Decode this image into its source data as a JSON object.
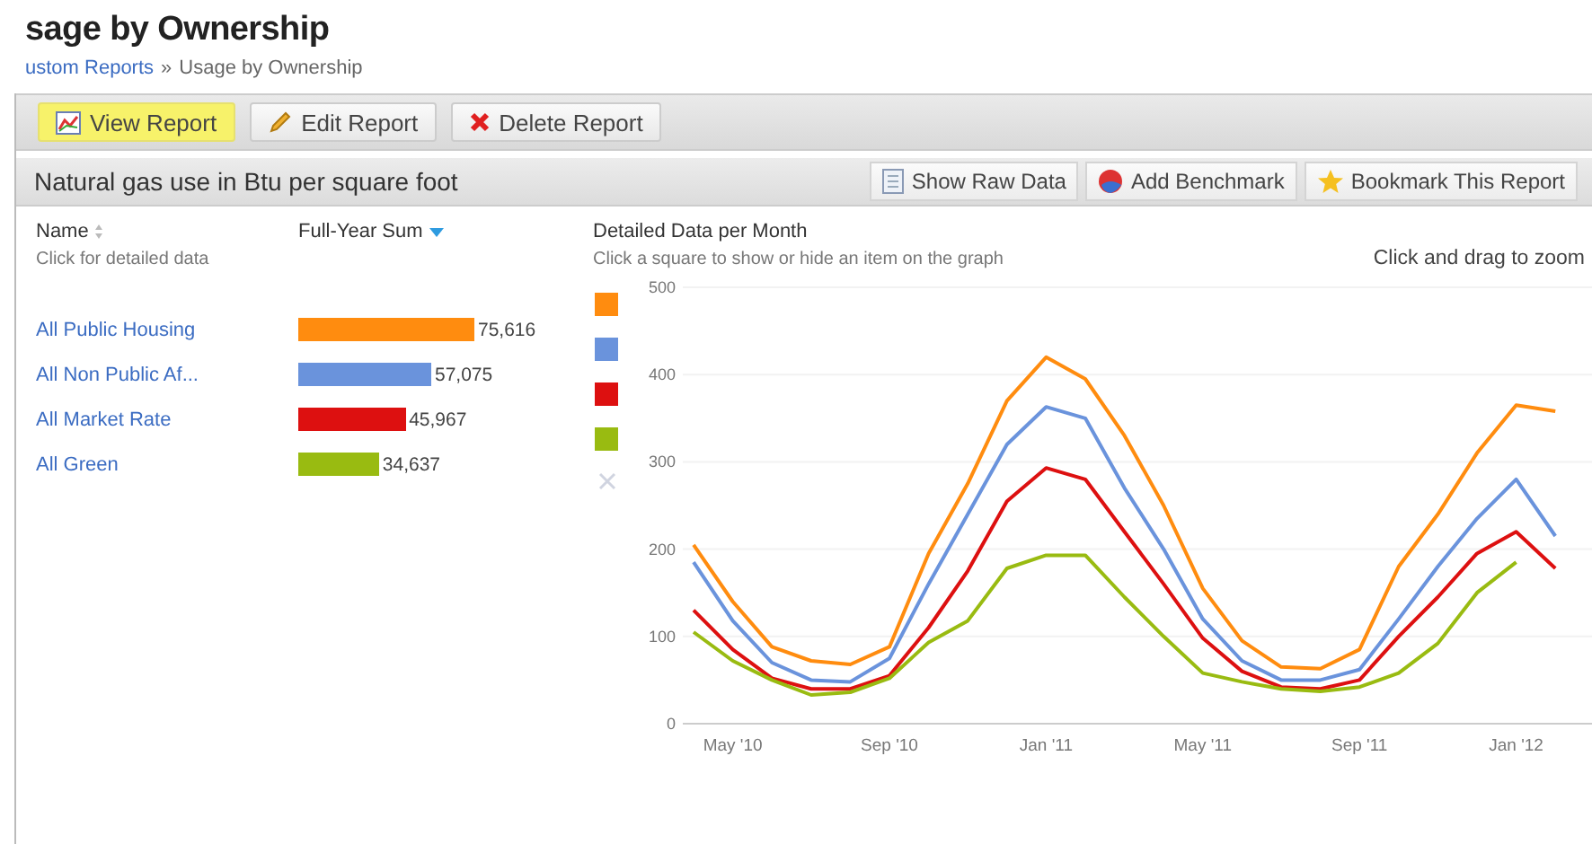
{
  "page": {
    "title": "sage by Ownership",
    "breadcrumb": [
      {
        "label": "ustom Reports"
      },
      {
        "label": "»"
      },
      {
        "label": "Usage by Ownership"
      }
    ]
  },
  "toolbar": [
    {
      "label": "View Report",
      "selected": true
    },
    {
      "label": "Edit Report",
      "selected": false
    },
    {
      "label": "Delete Report",
      "selected": false
    }
  ],
  "report_bar": {
    "subtitle": "Natural gas use in Btu per square foot",
    "actions": [
      {
        "label": "Show Raw Data"
      },
      {
        "label": "Add Benchmark"
      },
      {
        "label": "Bookmark This Report"
      }
    ]
  },
  "summary": {
    "name_heading": "Name",
    "name_hint": "Click for detailed data",
    "sum_heading": "Full-Year Sum",
    "rows": [
      {
        "name": "All Public Housing",
        "value": "75,616",
        "color": "#ff8c0f"
      },
      {
        "name": "All Non Public Af...",
        "value": "57,075",
        "color": "#6a93dc"
      },
      {
        "name": "All Market Rate",
        "value": "45,967",
        "color": "#dd1010"
      },
      {
        "name": "All Green",
        "value": "34,637",
        "color": "#99bb11"
      }
    ]
  },
  "detail": {
    "heading": "Detailed Data per Month",
    "hint": "Click a square to show or hide an item on the graph",
    "zoom_hint": "Click and drag to zoom",
    "chart_data": {
      "type": "line",
      "categories": [
        null,
        "May '10",
        null,
        null,
        null,
        "Sep '10",
        null,
        null,
        null,
        "Jan '11",
        null,
        null,
        null,
        "May '11",
        null,
        null,
        null,
        "Sep '11",
        null,
        null,
        null,
        "Jan '12",
        null
      ],
      "yticks": [
        0,
        100,
        200,
        300,
        400,
        500
      ],
      "ylim": [
        0,
        500
      ],
      "grid": true,
      "series": [
        {
          "color": "#ff8c0f",
          "values": [
            205,
            140,
            88,
            72,
            68,
            88,
            195,
            275,
            370,
            420,
            395,
            330,
            250,
            155,
            95,
            65,
            63,
            85,
            180,
            240,
            310,
            365,
            358
          ]
        },
        {
          "color": "#6a93dc",
          "values": [
            185,
            118,
            70,
            50,
            48,
            75,
            160,
            240,
            320,
            363,
            350,
            270,
            200,
            120,
            72,
            50,
            50,
            62,
            120,
            180,
            235,
            280,
            215
          ]
        },
        {
          "color": "#dd1010",
          "values": [
            130,
            85,
            52,
            40,
            40,
            55,
            110,
            175,
            255,
            293,
            280,
            220,
            160,
            98,
            60,
            42,
            40,
            50,
            100,
            145,
            195,
            220,
            178
          ]
        },
        {
          "color": "#99bb11",
          "values": [
            105,
            72,
            50,
            33,
            36,
            52,
            93,
            118,
            178,
            193,
            193,
            145,
            100,
            58,
            48,
            40,
            37,
            42,
            58,
            92,
            150,
            185,
            null
          ]
        }
      ]
    }
  }
}
